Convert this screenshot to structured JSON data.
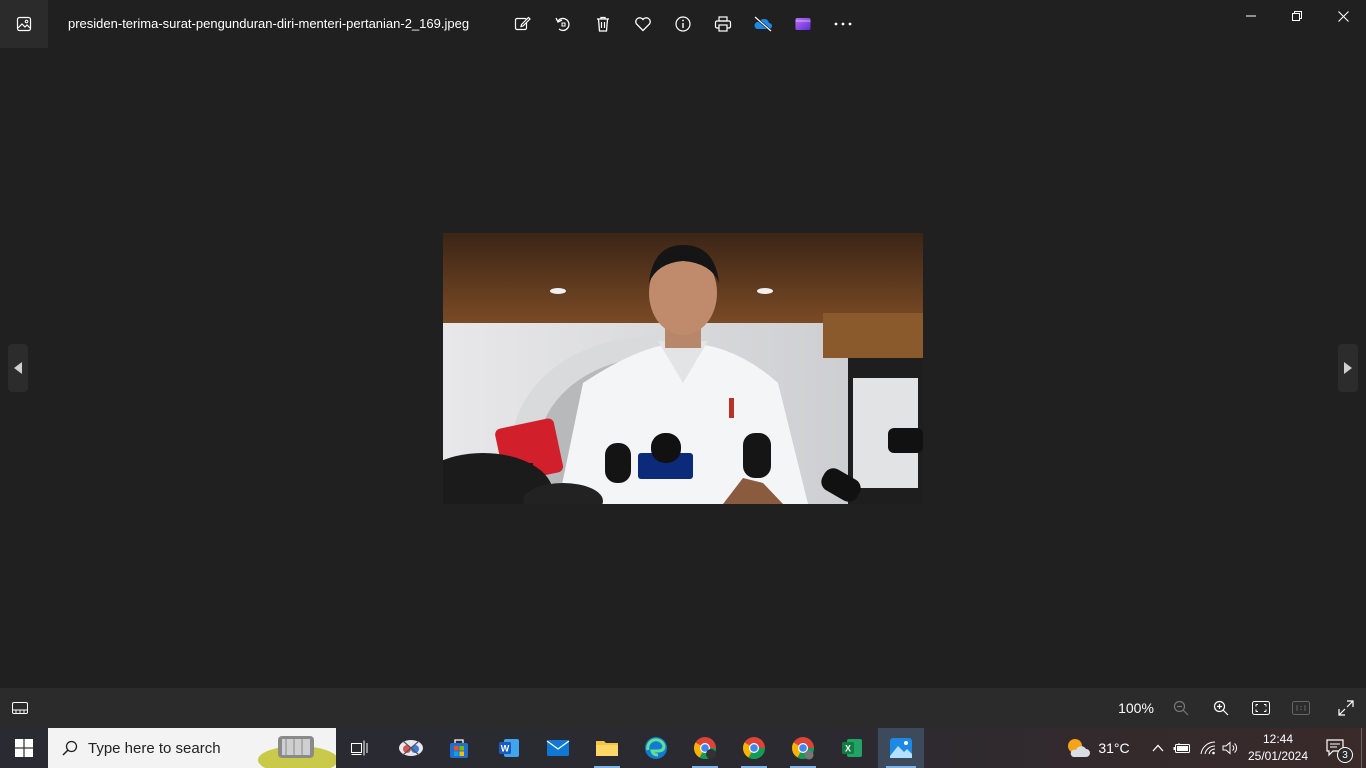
{
  "window": {
    "file_name": "presiden-terima-surat-pengunduran-diri-menteri-pertanian-2_169.jpeg"
  },
  "toolbar": {
    "items": [
      {
        "icon": "edit-image-icon"
      },
      {
        "icon": "rotate-icon"
      },
      {
        "icon": "delete-icon"
      },
      {
        "icon": "favorite-icon"
      },
      {
        "icon": "info-icon"
      },
      {
        "icon": "print-icon"
      },
      {
        "icon": "onedrive-icon"
      },
      {
        "icon": "clipchamp-icon"
      },
      {
        "icon": "more-options-icon"
      }
    ]
  },
  "viewer": {
    "zoom": "100%"
  },
  "taskbar": {
    "search_placeholder": "Type here to search",
    "weather_temp": "31°C",
    "time": "12:44",
    "date": "25/01/2024",
    "notification_count": "3"
  },
  "colors": {
    "background": "#202020",
    "bar": "#2b2b2b",
    "accent": "#7fb4e8"
  }
}
